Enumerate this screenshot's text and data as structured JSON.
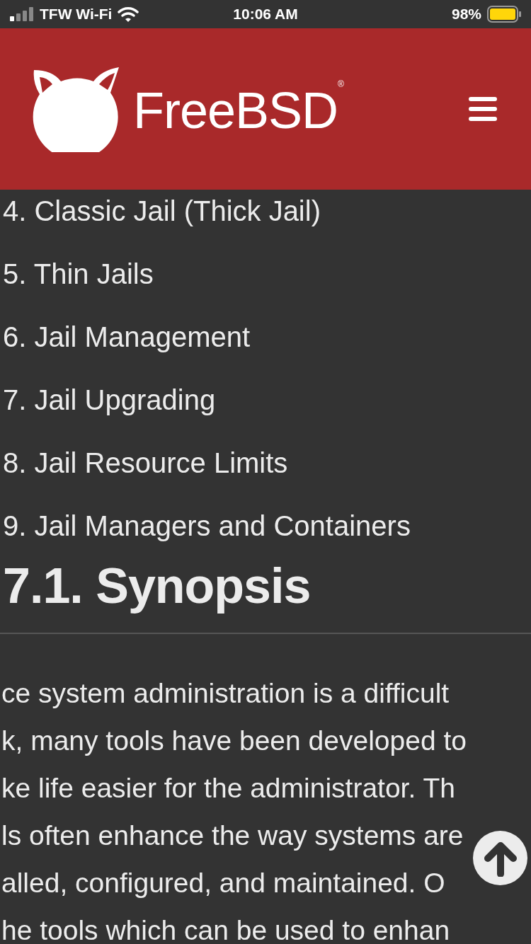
{
  "status_bar": {
    "carrier": "TFW Wi-Fi",
    "time": "10:06 AM",
    "battery": "98%"
  },
  "header": {
    "logo_text": "FreeBSD$^{®}$"
  },
  "toc": [
    "4. Classic Jail (Thick Jail)",
    "5. Thin Jails",
    "6. Jail Management",
    "7. Jail Upgrading",
    "8. Jail Resource Limits",
    "9. Jail Managers and Containers"
  ],
  "heading": "7.1. Synopsis",
  "paragraph_lines": [
    "ce system administration is a difficult",
    "k, many tools have been developed to",
    "ke life easier for the administrator. Th",
    "ls often enhance the way systems are",
    "alled, configured, and maintained. O",
    "he tools which can be used to enhan"
  ]
}
